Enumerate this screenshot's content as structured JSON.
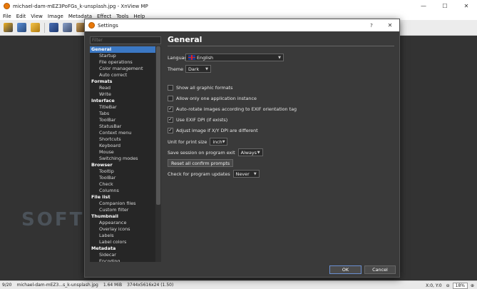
{
  "window": {
    "title": "michael-dam-mEZ3PoFGs_k-unsplash.jpg - XnView MP",
    "minimize": "—",
    "maximize": "☐",
    "close": "✕"
  },
  "menu": [
    "File",
    "Edit",
    "View",
    "Image",
    "Metadata",
    "Effect",
    "Tools",
    "Help"
  ],
  "watermark": "SOFTPEDIA",
  "status": {
    "index": "9/20",
    "file": "michael-dam-mEZ3...s_k-unsplash.jpg",
    "size": "1.64 MiB",
    "dims": "3744x5616x24 (1.50)",
    "coords": "X:0, Y:0",
    "zoom": "18%"
  },
  "dialog": {
    "title": "Settings",
    "help": "?",
    "close": "✕",
    "filter_placeholder": "Filter",
    "ok": "OK",
    "cancel": "Cancel"
  },
  "tree": [
    {
      "label": "General",
      "type": "group",
      "selected": true
    },
    {
      "label": "Startup",
      "type": "child"
    },
    {
      "label": "File operations",
      "type": "child"
    },
    {
      "label": "Color management",
      "type": "child"
    },
    {
      "label": "Auto correct",
      "type": "child"
    },
    {
      "label": "Formats",
      "type": "group"
    },
    {
      "label": "Read",
      "type": "child"
    },
    {
      "label": "Write",
      "type": "child"
    },
    {
      "label": "Interface",
      "type": "group"
    },
    {
      "label": "TitleBar",
      "type": "child"
    },
    {
      "label": "Tabs",
      "type": "child"
    },
    {
      "label": "ToolBar",
      "type": "child"
    },
    {
      "label": "StatusBar",
      "type": "child"
    },
    {
      "label": "Context menu",
      "type": "child"
    },
    {
      "label": "Shortcuts",
      "type": "child"
    },
    {
      "label": "Keyboard",
      "type": "child"
    },
    {
      "label": "Mouse",
      "type": "child"
    },
    {
      "label": "Switching modes",
      "type": "child"
    },
    {
      "label": "Browser",
      "type": "group"
    },
    {
      "label": "Tooltip",
      "type": "child"
    },
    {
      "label": "ToolBar",
      "type": "child"
    },
    {
      "label": "Check",
      "type": "child"
    },
    {
      "label": "Columns",
      "type": "child"
    },
    {
      "label": "File list",
      "type": "group"
    },
    {
      "label": "Companion files",
      "type": "child"
    },
    {
      "label": "Custom filter",
      "type": "child"
    },
    {
      "label": "Thumbnail",
      "type": "group"
    },
    {
      "label": "Appearance",
      "type": "child"
    },
    {
      "label": "Overlay icons",
      "type": "child"
    },
    {
      "label": "Labels",
      "type": "child"
    },
    {
      "label": "Label colors",
      "type": "child"
    },
    {
      "label": "Metadata",
      "type": "group"
    },
    {
      "label": "Sidecar",
      "type": "child"
    },
    {
      "label": "Encoding",
      "type": "child"
    }
  ],
  "general": {
    "heading": "General",
    "language_label": "Language",
    "language_value": "English",
    "theme_label": "Theme",
    "theme_value": "Dark",
    "show_all_formats": "Show all graphic formats",
    "single_instance": "Allow only one application instance",
    "auto_rotate": "Auto-rotate images according to EXIF orientation tag",
    "use_exif_dpi": "Use EXIF DPI (if exists)",
    "adjust_xy_dpi": "Adjust image if X/Y DPI are different",
    "unit_label": "Unit for print size",
    "unit_value": "inch",
    "save_session_label": "Save session on program exit",
    "save_session_value": "Always",
    "reset_prompts": "Reset all confirm prompts",
    "updates_label": "Check for program updates",
    "updates_value": "Never",
    "check_mark": "✓"
  },
  "colors": {
    "accent": "#3b78c4",
    "app_icon": "#e8780a"
  }
}
